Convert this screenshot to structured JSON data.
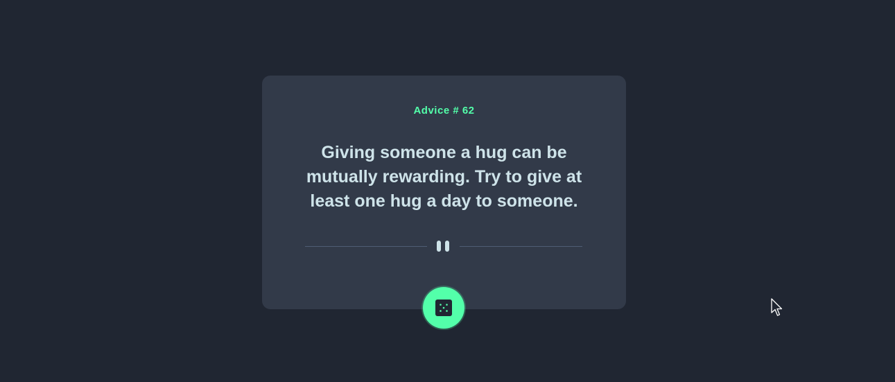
{
  "advice": {
    "id_label": "Advice # 62",
    "text": "Giving someone a hug can be mutually rewarding. Try to give at least one hug a day to someone."
  },
  "colors": {
    "background": "#202632",
    "card": "#323a49",
    "accent": "#53ffaa",
    "text": "#cee3e9",
    "divider": "#4f5d74"
  },
  "icons": {
    "divider": "pause-icon",
    "button": "dice-icon",
    "cursor": "mouse-pointer-icon"
  }
}
